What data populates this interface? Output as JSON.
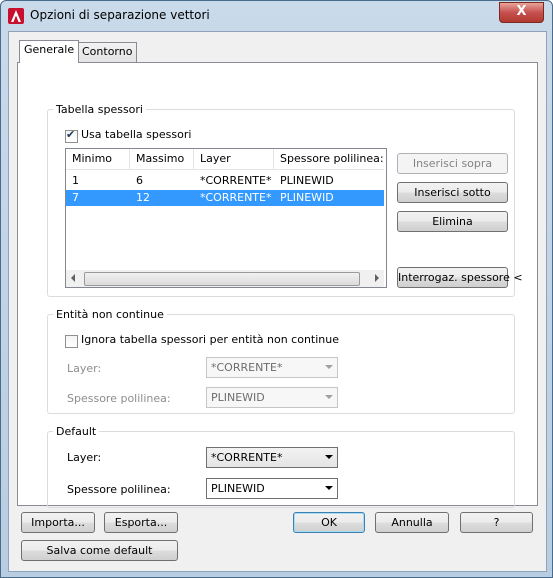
{
  "window": {
    "title": "Opzioni di separazione vettori",
    "close_label": "X"
  },
  "tabs": [
    {
      "label": "Generale"
    },
    {
      "label": "Contorno"
    }
  ],
  "weights_group": {
    "title": "Tabella spessori",
    "use_table_label": "Usa tabella spessori",
    "use_table_checked": true,
    "columns": [
      "Minimo",
      "Massimo",
      "Layer",
      "Spessore polilinea:"
    ],
    "rows": [
      {
        "min": "1",
        "max": "6",
        "layer": "*CORRENTE*",
        "width": "PLINEWID",
        "selected": false
      },
      {
        "min": "7",
        "max": "12",
        "layer": "*CORRENTE*",
        "width": "PLINEWID",
        "selected": true
      }
    ],
    "insert_above_label": "Inserisci sopra",
    "insert_below_label": "Inserisci sotto",
    "delete_label": "Elimina",
    "query_width_label": "Interrogaz. spessore <"
  },
  "noncontinuous_group": {
    "title": "Entità non continue",
    "ignore_label": "Ignora tabella spessori per entità non continue",
    "ignore_checked": false,
    "layer_label": "Layer:",
    "layer_value": "*CORRENTE*",
    "width_label": "Spessore polilinea:",
    "width_value": "PLINEWID"
  },
  "default_group": {
    "title": "Default",
    "layer_label": "Layer:",
    "layer_value": "*CORRENTE*",
    "width_label": "Spessore polilinea:",
    "width_value": "PLINEWID"
  },
  "footer": {
    "import_label": "Importa...",
    "export_label": "Esporta...",
    "ok_label": "OK",
    "cancel_label": "Annulla",
    "help_label": "?",
    "save_default_label": "Salva come default"
  }
}
